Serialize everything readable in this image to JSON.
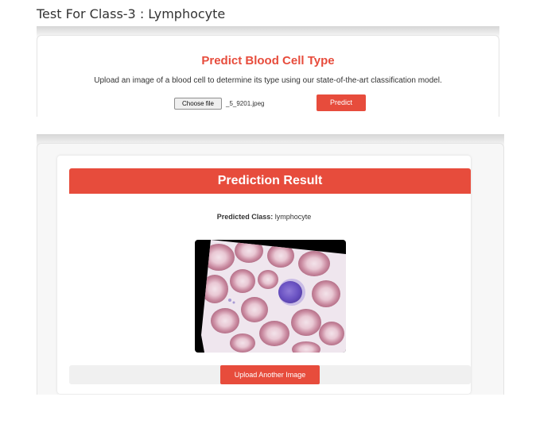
{
  "page": {
    "heading": "Test For Class-3 : Lymphocyte"
  },
  "upload_panel": {
    "title": "Predict Blood Cell Type",
    "description": "Upload an image of a blood cell to determine its type using our state-of-the-art classification model.",
    "choose_file_label": "Choose file",
    "file_name": "_5_9201.jpeg",
    "predict_label": "Predict"
  },
  "result_panel": {
    "title": "Prediction Result",
    "predicted_class_label": "Predicted Class:",
    "predicted_class_value": "lymphocyte",
    "image_icon": "blood-cell-microscope-image",
    "upload_another_label": "Upload Another Image"
  },
  "colors": {
    "accent": "#e74c3c",
    "text": "#333333",
    "card_bg": "#ffffff",
    "panel_bg": "#f7f7f7"
  }
}
